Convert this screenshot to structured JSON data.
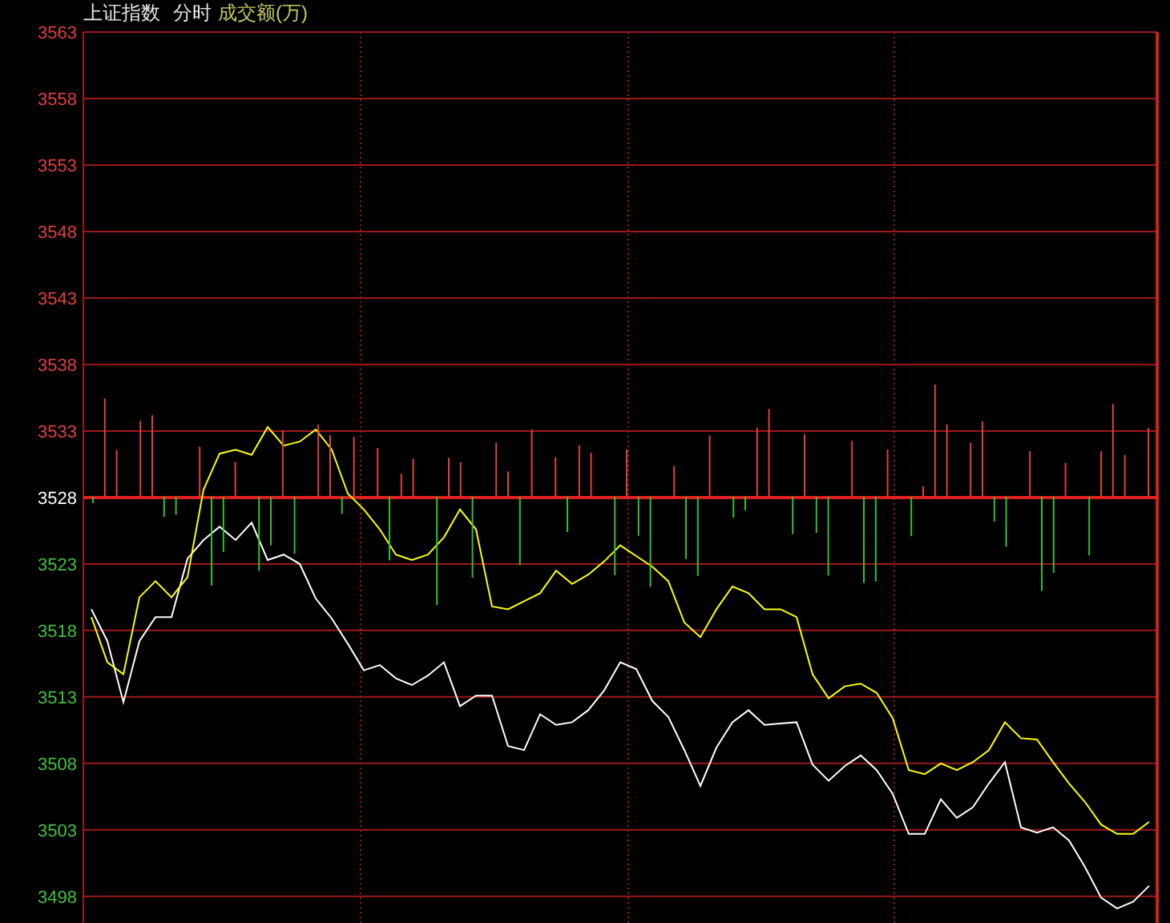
{
  "header": {
    "index_name": "上证指数",
    "period": "分时",
    "indicator": "成交额(万)"
  },
  "chart": {
    "chart_data": {
      "type": "line",
      "ylim": [
        3496,
        3563
      ],
      "grid": true,
      "ref_lines": [
        {
          "axis": "y",
          "value": 3528,
          "color": "#e02020"
        }
      ],
      "yticks": [
        {
          "value": 3563,
          "label": "3563"
        },
        {
          "value": 3558,
          "label": "3558"
        },
        {
          "value": 3553,
          "label": "3553"
        },
        {
          "value": 3548,
          "label": "3548"
        },
        {
          "value": 3543,
          "label": "3543"
        },
        {
          "value": 3538,
          "label": "3538"
        },
        {
          "value": 3533,
          "label": "3533"
        },
        {
          "value": 3528,
          "label": "3528"
        },
        {
          "value": 3523,
          "label": "3523"
        },
        {
          "value": 3518,
          "label": "3518"
        },
        {
          "value": 3513,
          "label": "3513"
        },
        {
          "value": 3508,
          "label": "3508"
        },
        {
          "value": 3503,
          "label": "3503"
        },
        {
          "value": 3498,
          "label": "3498"
        }
      ],
      "series": [
        {
          "color": "#ffffff",
          "values": [
            3519.6,
            3517.2,
            3512.6,
            3517.2,
            3519.0,
            3519.0,
            3523.4,
            3524.8,
            3525.8,
            3524.8,
            3526.1,
            3523.3,
            3523.7,
            3523.0,
            3520.4,
            3518.9,
            3517.0,
            3515.0,
            3515.4,
            3514.4,
            3513.9,
            3514.6,
            3515.6,
            3512.3,
            3513.1,
            3513.1,
            3509.3,
            3509.0,
            3511.7,
            3510.9,
            3511.1,
            3512.0,
            3513.5,
            3515.6,
            3515.1,
            3512.7,
            3511.5,
            3509.0,
            3506.3,
            3509.2,
            3511.1,
            3512.0,
            3510.9,
            3511.0,
            3511.1,
            3507.9,
            3506.7,
            3507.8,
            3508.6,
            3507.5,
            3505.7,
            3502.7,
            3502.7,
            3505.3,
            3503.9,
            3504.7,
            3506.5,
            3508.1,
            3503.2,
            3502.8,
            3503.2,
            3502.2,
            3500.2,
            3497.9,
            3497.1,
            3497.6,
            3498.8
          ]
        },
        {
          "color": "#ffff00",
          "values": [
            3519.0,
            3515.6,
            3514.7,
            3520.5,
            3521.7,
            3520.5,
            3522.0,
            3528.6,
            3531.3,
            3531.6,
            3531.2,
            3533.3,
            3531.9,
            3532.2,
            3533.1,
            3531.6,
            3528.3,
            3527.1,
            3525.6,
            3523.7,
            3523.3,
            3523.7,
            3525.0,
            3527.1,
            3525.6,
            3519.8,
            3519.6,
            3520.2,
            3520.8,
            3522.5,
            3521.5,
            3522.2,
            3523.2,
            3524.4,
            3523.6,
            3522.8,
            3521.7,
            3518.6,
            3517.5,
            3519.6,
            3521.3,
            3520.8,
            3519.6,
            3519.6,
            3519.0,
            3514.7,
            3512.9,
            3513.8,
            3514.0,
            3513.3,
            3511.4,
            3507.5,
            3507.2,
            3508.0,
            3507.5,
            3508.1,
            3509.0,
            3511.1,
            3509.9,
            3509.8,
            3508.1,
            3506.5,
            3505.1,
            3503.4,
            3502.7,
            3502.7,
            3503.6
          ]
        }
      ]
    }
  }
}
